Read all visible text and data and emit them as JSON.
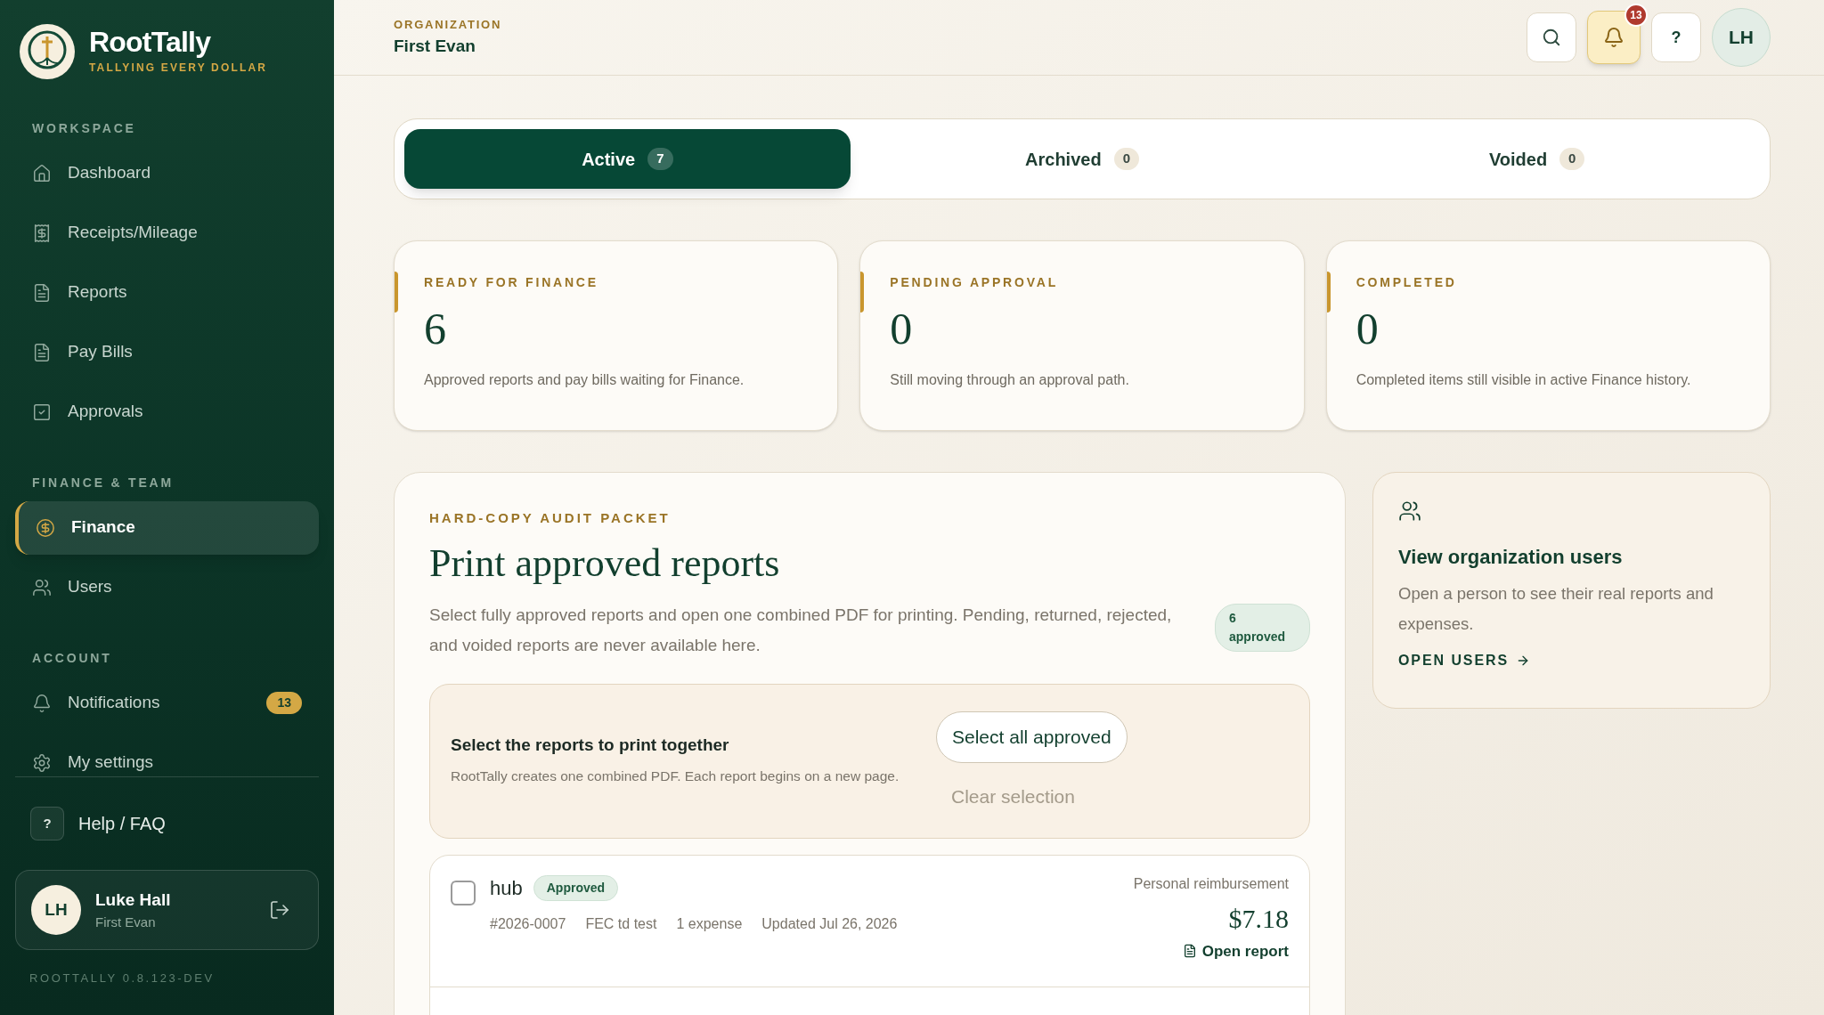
{
  "brand": {
    "name": "RootTally",
    "tagline": "TALLYING EVERY DOLLAR"
  },
  "sidebar": {
    "sections": [
      {
        "heading": "WORKSPACE",
        "items": [
          {
            "label": "Dashboard",
            "selected": false
          },
          {
            "label": "Receipts/Mileage",
            "selected": false
          },
          {
            "label": "Reports",
            "selected": false
          },
          {
            "label": "Pay Bills",
            "selected": false
          },
          {
            "label": "Approvals",
            "selected": false
          }
        ]
      },
      {
        "heading": "FINANCE & TEAM",
        "items": [
          {
            "label": "Finance",
            "selected": true
          },
          {
            "label": "Users",
            "selected": false
          }
        ]
      },
      {
        "heading": "ACCOUNT",
        "items": [
          {
            "label": "Notifications",
            "selected": false,
            "badge": "13"
          },
          {
            "label": "My settings",
            "selected": false
          }
        ]
      }
    ]
  },
  "help": {
    "icon_text": "?",
    "label": "Help / FAQ"
  },
  "user": {
    "initials": "LH",
    "name": "Luke Hall",
    "org": "First Evan"
  },
  "version": "ROOTTALLY 0.8.123-DEV",
  "header": {
    "label": "ORGANIZATION",
    "org": "First Evan",
    "notification_count": "13",
    "help_text": "?",
    "avatar": "LH"
  },
  "tabs": [
    {
      "label": "Active",
      "count": "7",
      "selected": true
    },
    {
      "label": "Archived",
      "count": "0",
      "selected": false
    },
    {
      "label": "Voided",
      "count": "0",
      "selected": false
    }
  ],
  "stats": [
    {
      "label": "READY FOR FINANCE",
      "value": "6",
      "description": "Approved reports and pay bills waiting for Finance."
    },
    {
      "label": "PENDING APPROVAL",
      "value": "0",
      "description": "Still moving through an approval path."
    },
    {
      "label": "COMPLETED",
      "value": "0",
      "description": "Completed items still visible in active Finance history."
    }
  ],
  "audit": {
    "eyebrow": "HARD-COPY AUDIT PACKET",
    "title": "Print approved reports",
    "description": "Select fully approved reports and open one combined PDF for printing. Pending, returned, rejected, and voided reports are never available here.",
    "badge_count": "6",
    "badge_label": "approved",
    "select_title": "Select the reports to print together",
    "select_note": "RootTally creates one combined PDF. Each report begins on a new page.",
    "select_all": "Select all approved",
    "clear": "Clear selection",
    "clear_disabled": true
  },
  "reports": [
    {
      "checked": false,
      "title": "hub",
      "badge": "Approved",
      "number": "#2026-0007",
      "event": "FEC td test",
      "expenses": "1 expense",
      "updated": "Updated Jul 26, 2026",
      "type": "Personal reimbursement",
      "amount": "$7.18",
      "link": "Open report"
    }
  ],
  "users_card": {
    "title": "View organization users",
    "description": "Open a person to see their real reports and expenses.",
    "link": "OPEN USERS"
  }
}
